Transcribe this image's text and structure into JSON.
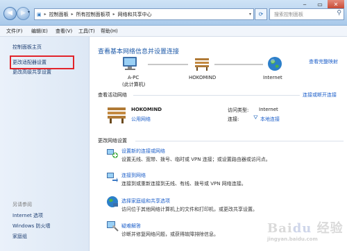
{
  "titlebar": {
    "breadcrumb": [
      "控制面板",
      "所有控制面板项",
      "网络和共享中心"
    ],
    "search_placeholder": "搜索控制面板"
  },
  "menu": [
    "文件(F)",
    "编辑(E)",
    "查看(V)",
    "工具(T)",
    "帮助(H)"
  ],
  "sidebar": {
    "home": "控制面板主页",
    "adapter": "更改适配器设置",
    "advanced": "更改高级共享设置",
    "see_also": "另请参阅",
    "links": [
      "Internet 选项",
      "Windows 防火墙",
      "家庭组"
    ]
  },
  "main": {
    "heading": "查看基本网络信息并设置连接",
    "view_full_map": "查看完整映射",
    "map": {
      "pc": "A-PC",
      "pc_sub": "(此计算机)",
      "network": "HOKOMIND",
      "internet": "Internet"
    },
    "active": {
      "title": "查看活动网络",
      "connect_link": "连接或断开连接",
      "name": "HOKOMIND",
      "type": "公用网络",
      "access_label": "访问类型:",
      "access_value": "Internet",
      "conn_label": "连接:",
      "conn_value": "本地连接"
    },
    "change": {
      "title": "更改网络设置",
      "items": [
        {
          "title": "设置新的连接或网络",
          "desc": "设置无线、宽带、拨号、临时或 VPN 连接；或设置路由器或访问点。"
        },
        {
          "title": "连接到网络",
          "desc": "连接到或重新连接到无线、有线、拨号或 VPN 网络连接。"
        },
        {
          "title": "选择家庭组和共享选项",
          "desc": "访问位于其他网络计算机上的文件和打印机，或更改共享设置。"
        },
        {
          "title": "疑难解答",
          "desc": "诊断并修复网络问题，或获得故障排除信息。"
        }
      ]
    }
  },
  "colors": {
    "link": "#1b5ec9",
    "highlight": "#e2232a",
    "heading": "#1e5aa8"
  }
}
